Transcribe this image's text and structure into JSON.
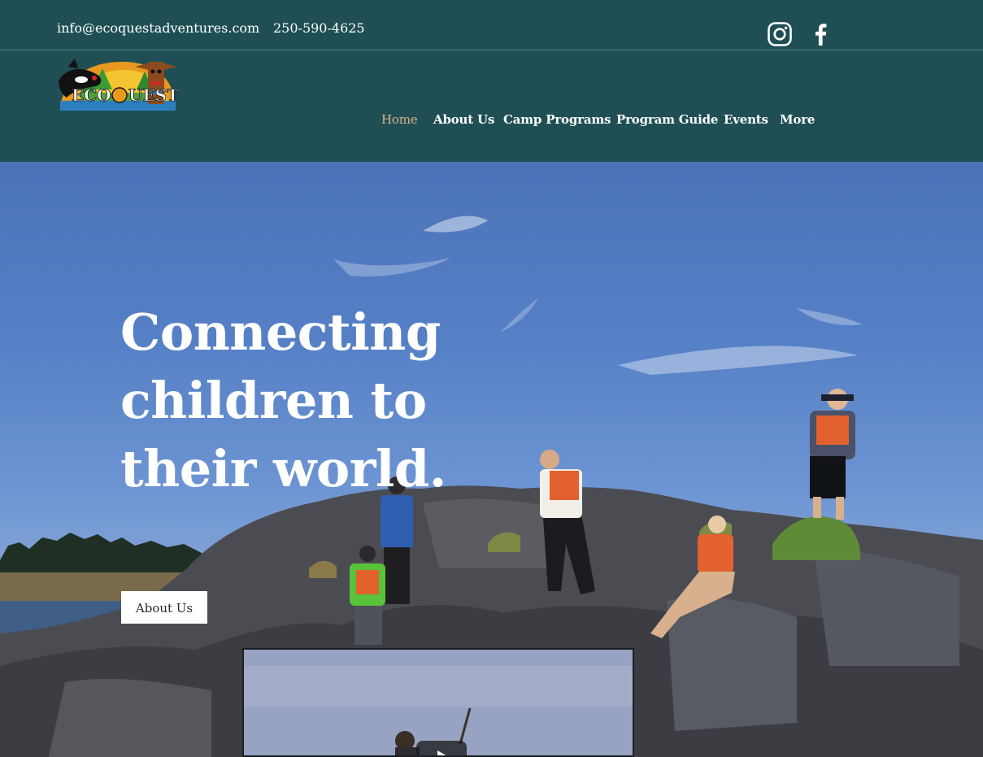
{
  "topbar": {
    "email": "info@ecoquestadventures.com",
    "phone": "250-590-4625",
    "social": [
      {
        "name": "instagram-icon"
      },
      {
        "name": "facebook-icon"
      }
    ]
  },
  "header": {
    "logo_text": "ECOQUEST",
    "nav": [
      {
        "label": "Home",
        "active": true
      },
      {
        "label": "About Us",
        "active": false
      },
      {
        "label": "Camp Programs",
        "active": false
      },
      {
        "label": "Program Guide",
        "active": false
      },
      {
        "label": "Events",
        "active": false
      },
      {
        "label": "More",
        "active": false
      }
    ]
  },
  "hero": {
    "headline_lines": [
      "Connecting",
      "children to",
      "their world."
    ],
    "cta_label": "About Us"
  },
  "video": {
    "play_icon": "play-icon"
  },
  "colors": {
    "header_bg": "#1f4f55",
    "nav_active": "#d7b487",
    "text": "#ffffff",
    "cta_bg": "#ffffff"
  }
}
